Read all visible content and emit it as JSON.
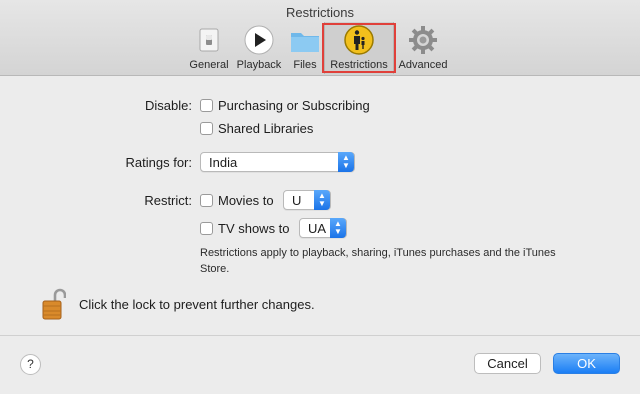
{
  "window": {
    "title": "Restrictions"
  },
  "toolbar": {
    "tabs": [
      {
        "label": "General",
        "icon": "general-switch-icon"
      },
      {
        "label": "Playback",
        "icon": "play-icon"
      },
      {
        "label": "Files",
        "icon": "folder-icon"
      },
      {
        "label": "Restrictions",
        "icon": "parental-restrictions-icon",
        "selected": true
      },
      {
        "label": "Advanced",
        "icon": "gear-icon"
      }
    ]
  },
  "disable": {
    "label": "Disable:",
    "options": [
      {
        "label": "Purchasing or Subscribing",
        "checked": false
      },
      {
        "label": "Shared Libraries",
        "checked": false
      }
    ]
  },
  "ratings": {
    "label": "Ratings for:",
    "value": "India"
  },
  "restrict": {
    "label": "Restrict:",
    "movies": {
      "label": "Movies to",
      "checked": false,
      "value": "U"
    },
    "tv": {
      "label": "TV shows to",
      "checked": false,
      "value": "UA"
    },
    "note": "Restrictions apply to playback, sharing, iTunes purchases and the iTunes Store."
  },
  "lock": {
    "text": "Click the lock to prevent further changes.",
    "icon": "lock-open-icon"
  },
  "footer": {
    "help": "?",
    "cancel": "Cancel",
    "ok": "OK"
  },
  "colors": {
    "accent": "#1b7ef5",
    "highlight": "#e0403a"
  }
}
